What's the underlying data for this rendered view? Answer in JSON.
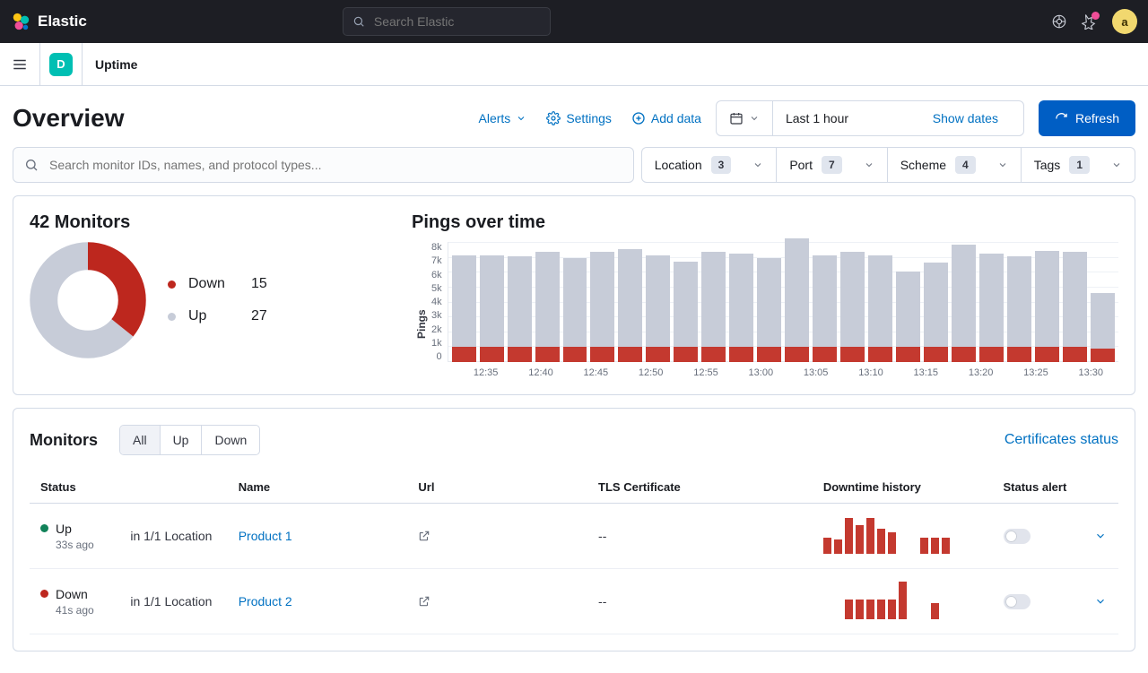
{
  "header": {
    "brand": "Elastic",
    "search_placeholder": "Search Elastic",
    "avatar_initial": "a"
  },
  "breadcrumb": {
    "space_initial": "D",
    "app": "Uptime"
  },
  "page": {
    "title": "Overview",
    "actions": {
      "alerts": "Alerts",
      "settings": "Settings",
      "add_data": "Add data"
    },
    "date_picker": {
      "range": "Last 1 hour",
      "show_dates": "Show dates"
    },
    "refresh": "Refresh",
    "search_placeholder": "Search monitor IDs, names, and protocol types..."
  },
  "facets": [
    {
      "label": "Location",
      "count": "3"
    },
    {
      "label": "Port",
      "count": "7"
    },
    {
      "label": "Scheme",
      "count": "4"
    },
    {
      "label": "Tags",
      "count": "1"
    }
  ],
  "monitors_summary": {
    "title": "42 Monitors",
    "down": {
      "label": "Down",
      "count": "15"
    },
    "up": {
      "label": "Up",
      "count": "27"
    }
  },
  "pings": {
    "title": "Pings over time",
    "ylabel": "Pings"
  },
  "chart_data": [
    {
      "type": "pie",
      "title": "42 Monitors",
      "categories": [
        "Down",
        "Up"
      ],
      "values": [
        15,
        27
      ],
      "colors": [
        "#bd271e",
        "#c7ccd8"
      ]
    },
    {
      "type": "bar",
      "title": "Pings over time",
      "ylabel": "Pings",
      "ylim": [
        0,
        8000
      ],
      "yticks": [
        "8k",
        "7k",
        "6k",
        "5k",
        "4k",
        "3k",
        "2k",
        "1k",
        "0"
      ],
      "xticks": [
        "12:35",
        "12:40",
        "12:45",
        "12:50",
        "12:55",
        "13:00",
        "13:05",
        "13:10",
        "13:15",
        "13:20",
        "13:25",
        "13:30"
      ],
      "series": [
        {
          "name": "Down",
          "color": "#c4392f",
          "values": [
            1000,
            1000,
            1000,
            1000,
            1000,
            1000,
            1000,
            1000,
            1000,
            1000,
            1000,
            1000,
            1000,
            1000,
            1000,
            1000,
            1000,
            1000,
            1000,
            1000,
            1000,
            1000,
            1000,
            900
          ]
        },
        {
          "name": "Up",
          "color": "#c7ccd8",
          "values": [
            6100,
            6100,
            6000,
            6300,
            5900,
            6300,
            6500,
            6100,
            5700,
            6300,
            6200,
            5900,
            7200,
            6100,
            6300,
            6100,
            5000,
            5600,
            6800,
            6200,
            6000,
            6400,
            6300,
            3700
          ]
        }
      ]
    }
  ],
  "monitors_section": {
    "title": "Monitors",
    "tabs": {
      "all": "All",
      "up": "Up",
      "down": "Down"
    },
    "certificates_link": "Certificates status",
    "columns": {
      "status": "Status",
      "name": "Name",
      "url": "Url",
      "tls": "TLS Certificate",
      "downtime": "Downtime history",
      "alert": "Status alert"
    }
  },
  "monitors_rows": [
    {
      "status": "Up",
      "status_color": "#118259",
      "ago": "33s ago",
      "location": "in 1/1 Location",
      "name": "Product 1",
      "tls": "--",
      "sparkline": [
        18,
        16,
        40,
        32,
        40,
        28,
        24,
        0,
        0,
        18,
        18,
        18
      ]
    },
    {
      "status": "Down",
      "status_color": "#bd271e",
      "ago": "41s ago",
      "location": "in 1/1 Location",
      "name": "Product 2",
      "tls": "--",
      "sparkline": [
        0,
        0,
        22,
        22,
        22,
        22,
        22,
        42,
        0,
        0,
        18,
        0
      ]
    }
  ]
}
